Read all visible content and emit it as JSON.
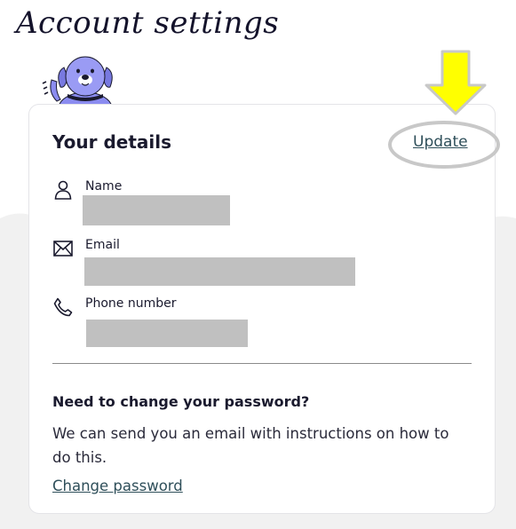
{
  "page": {
    "title": "Account settings"
  },
  "details": {
    "title": "Your details",
    "update_label": "Update",
    "fields": [
      {
        "label": "Name",
        "icon": "person-icon"
      },
      {
        "label": "Email",
        "icon": "envelope-icon"
      },
      {
        "label": "Phone number",
        "icon": "phone-icon"
      }
    ]
  },
  "password": {
    "heading": "Need to change your password?",
    "description": "We can send you an email with instructions on how to do this.",
    "link_label": "Change password"
  },
  "annotation": {
    "arrow_color": "#ffff00",
    "highlight_ring_color": "#c8c8c8"
  },
  "colors": {
    "link": "#2f4f5a",
    "redaction": "#c0c0c0",
    "mascot": "#8b8cf0"
  }
}
